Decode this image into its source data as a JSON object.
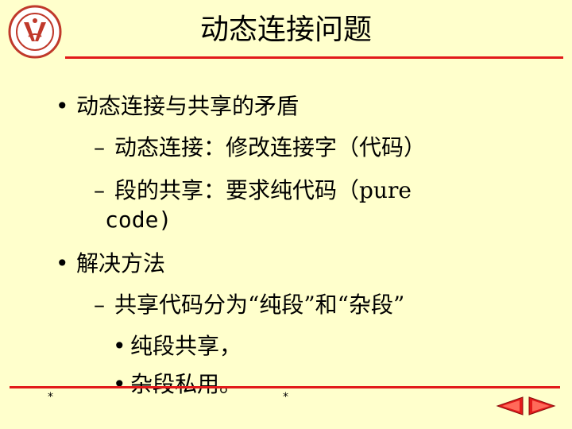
{
  "title": "动态连接问题",
  "logo": {
    "icon": "university-seal-icon"
  },
  "bullets": [
    {
      "marker": "•",
      "text": "动态连接与共享的矛盾"
    },
    {
      "marker": "–",
      "text": "动态连接：修改连接字（代码）"
    },
    {
      "marker": "–",
      "text": "段的共享：要求纯代码（pure"
    },
    {
      "marker": "",
      "text": "code)"
    },
    {
      "marker": "•",
      "text": "解决方法"
    },
    {
      "marker": "–",
      "text": "共享代码分为“纯段”和“杂段”"
    },
    {
      "marker": "•",
      "text": "纯段共享，"
    },
    {
      "marker": "•",
      "text": "杂段私用。"
    }
  ],
  "footer": {
    "left_mark": "*",
    "center_mark": "*"
  },
  "nav": {
    "prev_icon": "prev-arrow-icon",
    "next_icon": "next-arrow-icon"
  },
  "colors": {
    "background": "#FFFFCC",
    "rule": "#E21A1A",
    "nav": "#E21A1A"
  }
}
